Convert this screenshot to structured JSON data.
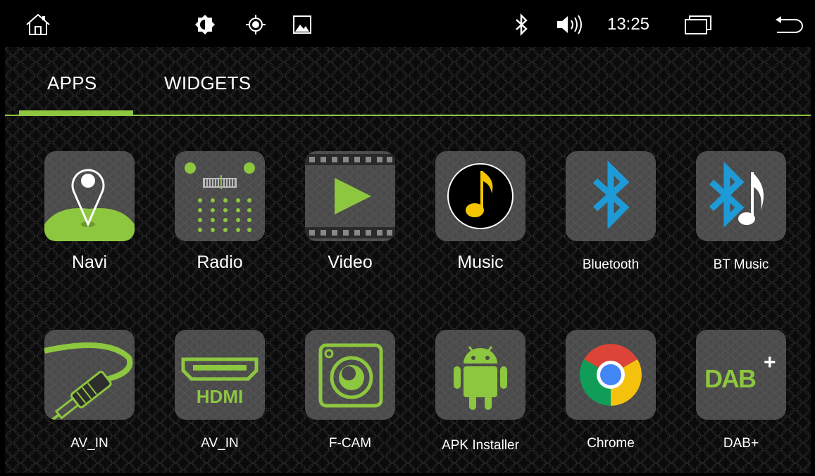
{
  "statusbar": {
    "time": "13:25",
    "icons": [
      "home-icon",
      "brightness-icon",
      "gps-icon",
      "wallpaper-icon",
      "bluetooth-icon",
      "volume-icon",
      "recent-apps-icon",
      "back-icon"
    ]
  },
  "tabs": [
    {
      "label": "APPS",
      "active": true
    },
    {
      "label": "WIDGETS",
      "active": false
    }
  ],
  "apps": [
    {
      "label": "Navi",
      "icon": "navi-icon"
    },
    {
      "label": "Radio",
      "icon": "radio-icon"
    },
    {
      "label": "Video",
      "icon": "video-icon"
    },
    {
      "label": "Music",
      "icon": "music-icon"
    },
    {
      "label": "Bluetooth",
      "icon": "bluetooth-app-icon"
    },
    {
      "label": "BT Music",
      "icon": "bt-music-icon"
    },
    {
      "label": "AV_IN",
      "icon": "av-in-cable-icon"
    },
    {
      "label": "AV_IN",
      "icon": "hdmi-icon"
    },
    {
      "label": "F-CAM",
      "icon": "camera-icon"
    },
    {
      "label": "APK Installer",
      "icon": "android-icon"
    },
    {
      "label": "Chrome",
      "icon": "chrome-icon"
    },
    {
      "label": "DAB+",
      "icon": "dab-plus-icon"
    }
  ],
  "colors": {
    "accent": "#8dc63f",
    "tile": "#4a4a4a",
    "bluetooth_blue": "#1e9ad6",
    "music_yellow": "#f2c500"
  }
}
